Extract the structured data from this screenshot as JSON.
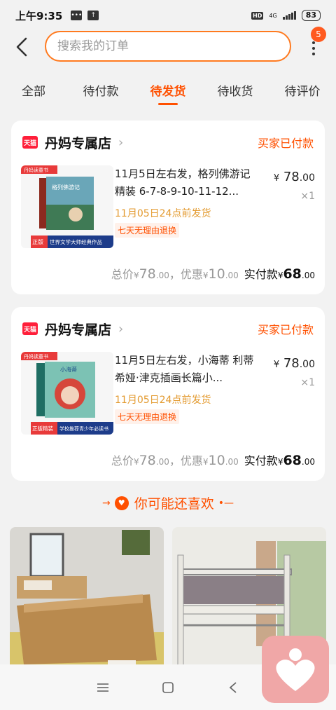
{
  "status_bar": {
    "time": "上午9:35",
    "hd": "HD",
    "network": "4G",
    "battery": "83"
  },
  "header": {
    "search_placeholder": "搜索我的订单",
    "badge_count": "5"
  },
  "tabs": [
    {
      "label": "全部",
      "active": false
    },
    {
      "label": "待付款",
      "active": false
    },
    {
      "label": "待发货",
      "active": true
    },
    {
      "label": "待收货",
      "active": false
    },
    {
      "label": "待评价",
      "active": false
    }
  ],
  "orders": [
    {
      "store_tag": "天猫",
      "shop_name": "丹妈专属店",
      "status": "买家已付款",
      "title": "11月5日左右发，格列佛游记 精装 6-7-8-9-10-11-12...",
      "ship_note": "11月05日24点前发货",
      "return_tag": "七天无理由退换",
      "price_currency": "¥",
      "price_int": "78",
      "price_dec": ".00",
      "qty": "×1",
      "total_label": "总价",
      "total_val": "78",
      "discount_label": "，优惠",
      "discount_val": "10",
      "paid_label": "实付款",
      "paid_val": "68",
      "cover_label": "丹妈读童书",
      "cover_book_title": "格列佛游记",
      "cover_bottom_a": "正版",
      "cover_bottom_b": "世界文学大师经典作品"
    },
    {
      "store_tag": "天猫",
      "shop_name": "丹妈专属店",
      "status": "买家已付款",
      "title": "11月5日左右发，小海蒂 利蒂希娅·津克插画长篇小...",
      "ship_note": "11月05日24点前发货",
      "return_tag": "七天无理由退换",
      "price_currency": "¥",
      "price_int": "78",
      "price_dec": ".00",
      "qty": "×1",
      "total_label": "总价",
      "total_val": "78",
      "discount_label": "，优惠",
      "discount_val": "10",
      "paid_label": "实付款",
      "paid_val": "68",
      "cover_label": "丹妈读童书",
      "cover_book_title": "小海蒂",
      "cover_bottom_a": "正版精装",
      "cover_bottom_b": "学校推荐青少年必读书"
    }
  ],
  "recommend": {
    "heading": "你可能还喜欢",
    "deco_left": "→",
    "deco_right": "•—"
  },
  "colors": {
    "accent": "#ff5000",
    "search_border": "#ff7a1f",
    "ship_note": "#e39a2f",
    "tmall": "#ff1f3a"
  }
}
